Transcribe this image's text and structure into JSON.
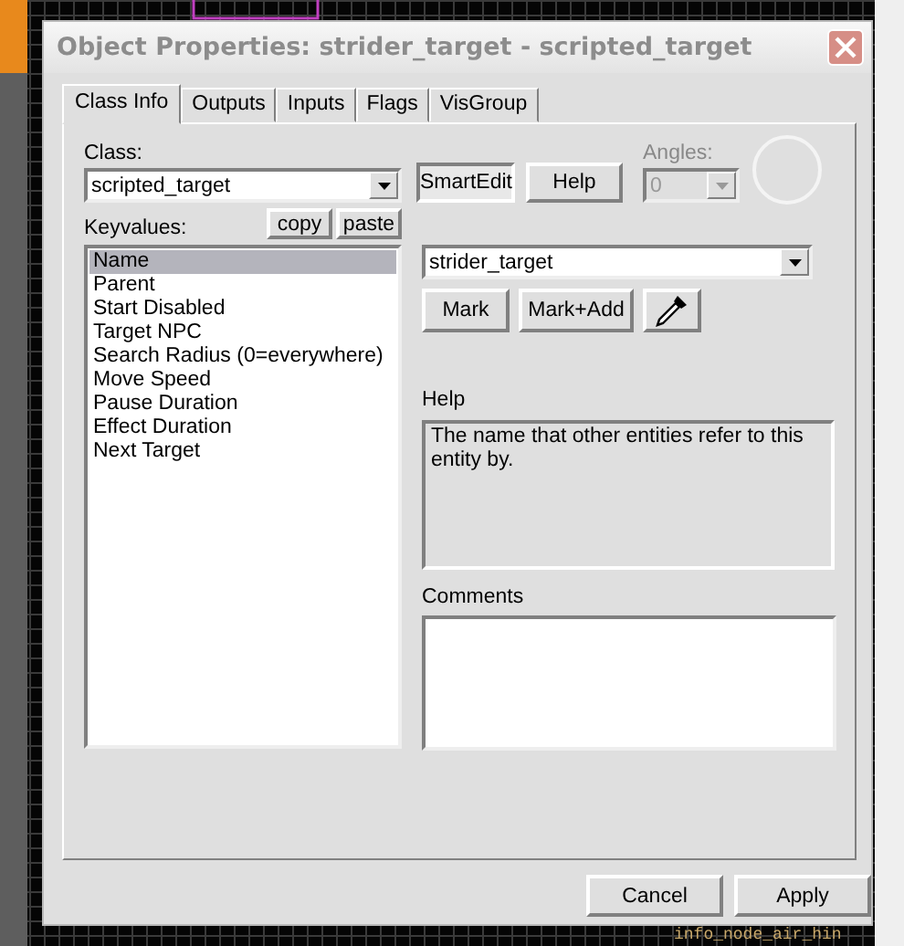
{
  "window": {
    "title": "Object Properties: strider_target - scripted_target"
  },
  "tabs": [
    {
      "label": "Class Info",
      "selected": true
    },
    {
      "label": "Outputs",
      "selected": false
    },
    {
      "label": "Inputs",
      "selected": false
    },
    {
      "label": "Flags",
      "selected": false
    },
    {
      "label": "VisGroup",
      "selected": false
    }
  ],
  "class": {
    "label": "Class:",
    "value": "scripted_target"
  },
  "smartedit_button": {
    "label": "SmartEdit",
    "pressed": true
  },
  "help_button": {
    "label": "Help"
  },
  "angles": {
    "label": "Angles:",
    "value": "0",
    "disabled": true
  },
  "keyvalues": {
    "label": "Keyvalues:",
    "buttons": [
      "copy",
      "paste"
    ],
    "items": [
      {
        "label": "Name",
        "selected": true
      },
      {
        "label": "Parent",
        "selected": false
      },
      {
        "label": "Start Disabled",
        "selected": false
      },
      {
        "label": "Target NPC",
        "selected": false
      },
      {
        "label": "Search Radius (0=everywhere)",
        "selected": false
      },
      {
        "label": "Move Speed",
        "selected": false
      },
      {
        "label": "Pause Duration",
        "selected": false
      },
      {
        "label": "Effect Duration",
        "selected": false
      },
      {
        "label": "Next Target",
        "selected": false
      }
    ]
  },
  "value_field": {
    "value": "strider_target"
  },
  "value_buttons": [
    "Mark",
    "Mark+Add"
  ],
  "help": {
    "label": "Help",
    "text": "The name that other entities refer to this entity by."
  },
  "comments": {
    "label": "Comments"
  },
  "footer_buttons": [
    "Cancel",
    "Apply"
  ],
  "viewport_label": "info_node_air_hin"
}
